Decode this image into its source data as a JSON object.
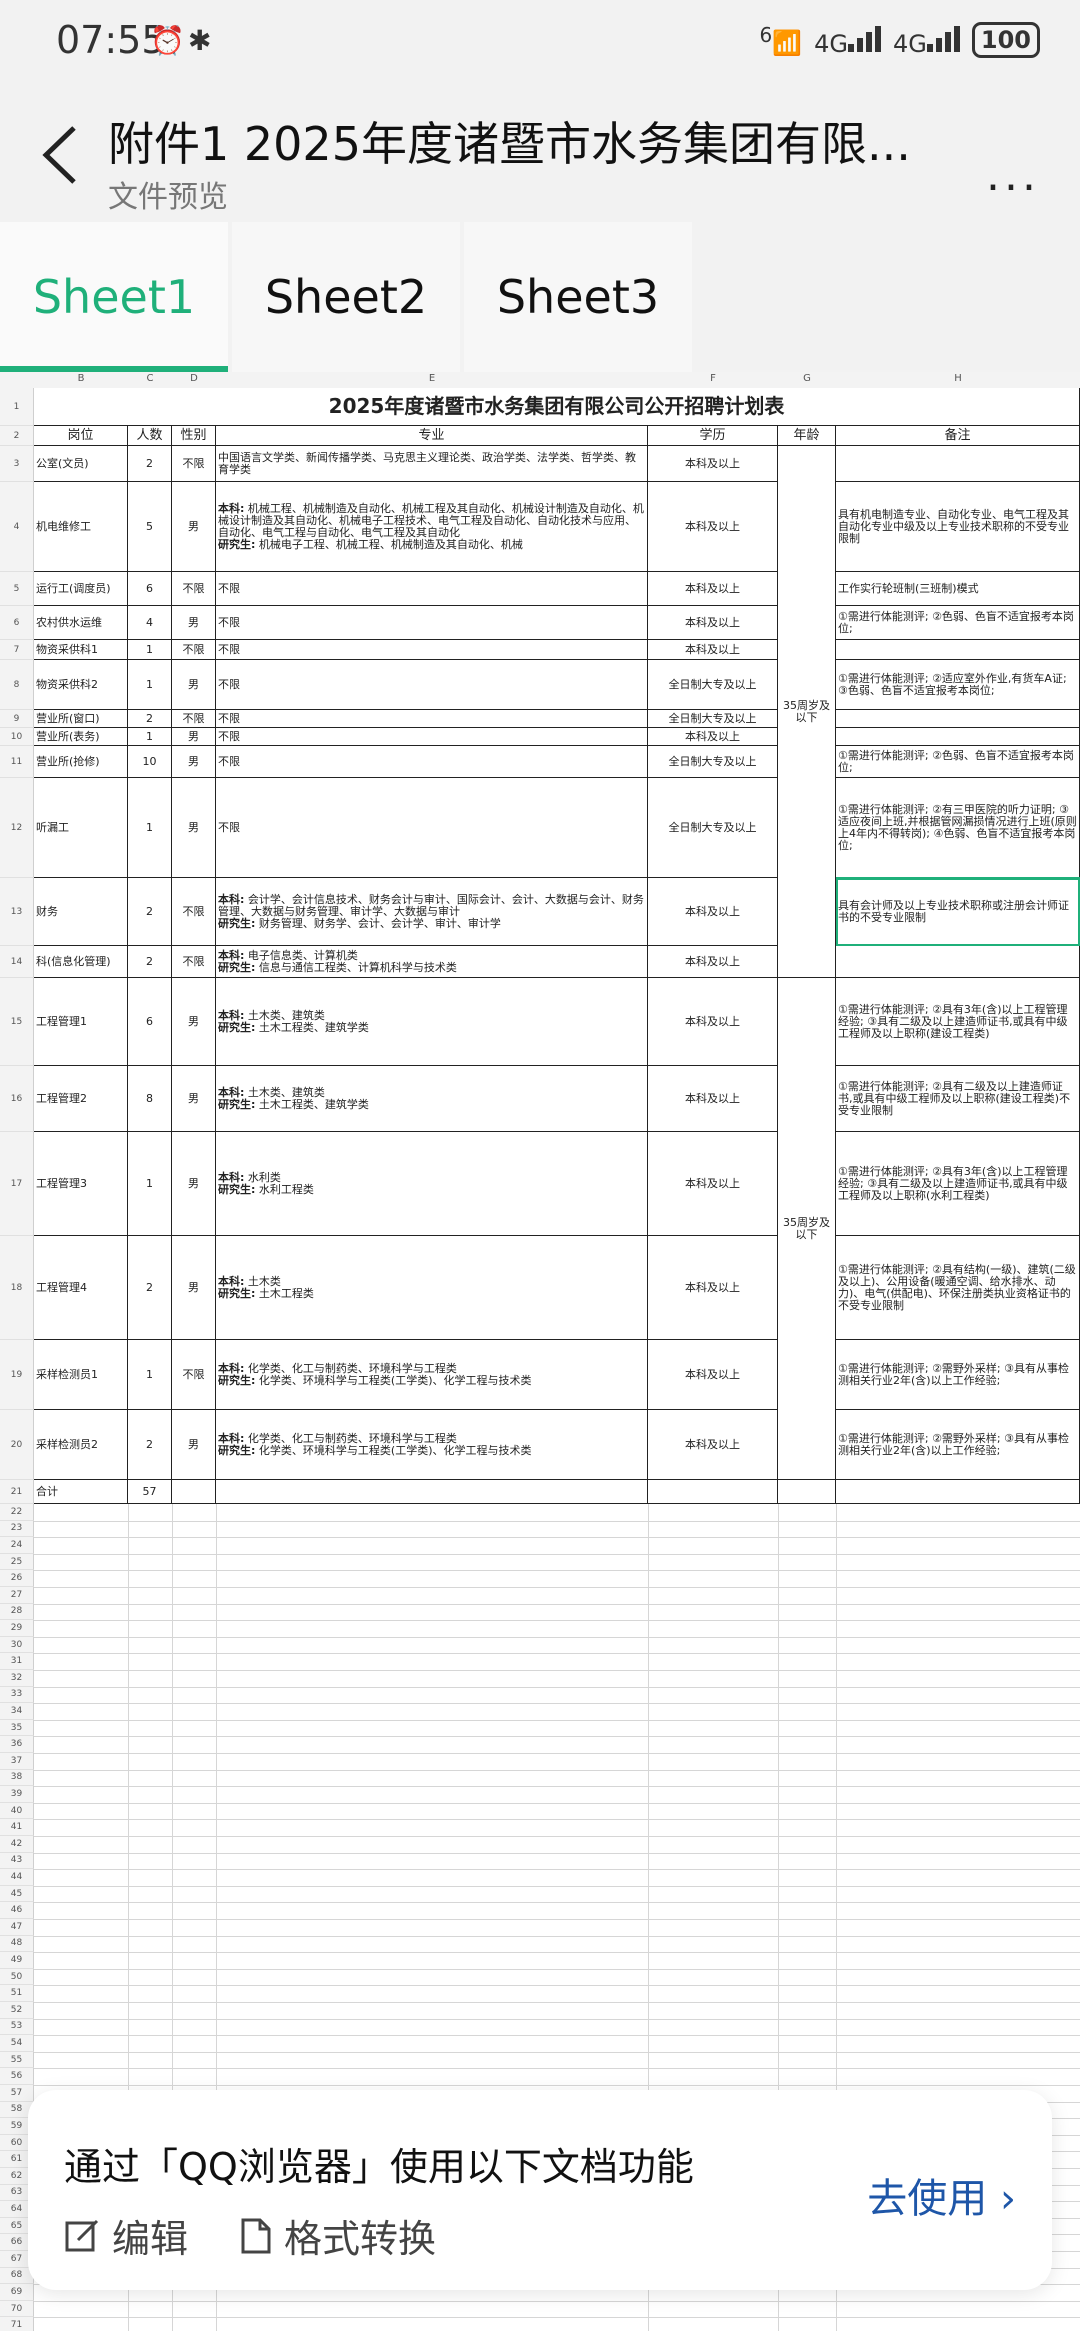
{
  "status": {
    "time": "07:55",
    "alarm_icon": "alarm-icon",
    "bluetooth_icon": "bluetooth-icon",
    "wifi_label": "6",
    "net1": "4G",
    "net2": "4G",
    "battery": "100"
  },
  "header": {
    "title": "附件1 2025年度诸暨市水务集团有限...",
    "subtitle": "文件预览",
    "more": "..."
  },
  "tabs": [
    {
      "label": "Sheet1",
      "active": true
    },
    {
      "label": "Sheet2",
      "active": false
    },
    {
      "label": "Sheet3",
      "active": false
    }
  ],
  "sheet": {
    "col_headers": [
      "B",
      "C",
      "D",
      "E",
      "F",
      "G",
      "H"
    ],
    "title": "2025年度诸暨市水务集团有限公司公开招聘计划表",
    "headers": {
      "post": "岗位",
      "count": "人数",
      "gender": "性别",
      "major": "专业",
      "edu": "学历",
      "age": "年龄",
      "note": "备注"
    },
    "age_groups": [
      "35周岁及以下",
      "35周岁及以下"
    ],
    "rows": [
      {
        "n": "3",
        "post": "公室(文员)",
        "count": "2",
        "gender": "不限",
        "major": "中国语言文学类、新闻传播学类、马克思主义理论类、政治学类、法学类、哲学类、教育学类",
        "edu": "本科及以上",
        "note": ""
      },
      {
        "n": "4",
        "post": "机电维修工",
        "count": "5",
        "gender": "男",
        "major_b1": "本科:",
        "major": " 机械工程、机械制造及自动化、机械工程及其自动化、机械设计制造及自动化、机械设计制造及其自动化、机械电子工程技术、电气工程及自动化、自动化技术与应用、自动化、电气工程与自动化、电气工程及其自动化",
        "major_b2": "研究生:",
        "major2": " 机械电子工程、机械工程、机械制造及其自动化、机械",
        "edu": "本科及以上",
        "note": "具有机电制造专业、自动化专业、电气工程及其自动化专业中级及以上专业技术职称的不受专业限制"
      },
      {
        "n": "5",
        "post": "运行工(调度员)",
        "count": "6",
        "gender": "不限",
        "major": "不限",
        "edu": "本科及以上",
        "note": "工作实行轮班制(三班制)模式"
      },
      {
        "n": "6",
        "post": "农村供水运维",
        "count": "4",
        "gender": "男",
        "major": "不限",
        "edu": "本科及以上",
        "note": "①需进行体能测评;      ②色弱、色盲不适宜报考本岗位;"
      },
      {
        "n": "7",
        "post": "物资采供科1",
        "count": "1",
        "gender": "不限",
        "major": "不限",
        "edu": "本科及以上",
        "note": ""
      },
      {
        "n": "8",
        "post": "物资采供科2",
        "count": "1",
        "gender": "男",
        "major": "不限",
        "edu": "全日制大专及以上",
        "note": "①需进行体能测评;      ②适应室外作业,有货车A证;      ③色弱、色盲不适宜报考本岗位;"
      },
      {
        "n": "9",
        "post": "营业所(窗口)",
        "count": "2",
        "gender": "不限",
        "major": "不限",
        "edu": "全日制大专及以上",
        "note": ""
      },
      {
        "n": "10",
        "post": "营业所(表务)",
        "count": "1",
        "gender": "男",
        "major": "不限",
        "edu": "本科及以上",
        "note": ""
      },
      {
        "n": "11",
        "post": "营业所(抢修)",
        "count": "10",
        "gender": "男",
        "major": "不限",
        "edu": "全日制大专及以上",
        "note": "①需进行体能测评;      ②色弱、色盲不适宜报考本岗位;"
      },
      {
        "n": "12",
        "post": "听漏工",
        "count": "1",
        "gender": "男",
        "major": "不限",
        "edu": "全日制大专及以上",
        "note": "①需进行体能测评;      ②有三甲医院的听力证明;      ③适应夜间上班,并根据管网漏损情况进行上班(原则上4年内不得转岗);      ④色弱、色盲不适宜报考本岗位;"
      },
      {
        "n": "13",
        "post": "财务",
        "count": "2",
        "gender": "不限",
        "major_b1": "本科:",
        "major": " 会计学、会计信息技术、财务会计与审计、国际会计、会计、大数据与会计、财务管理、大数据与财务管理、审计学、大数据与审计",
        "major_b2": "研究生:",
        "major2": " 财务管理、财务学、会计、会计学、审计、审计学",
        "edu": "本科及以上",
        "note": "具有会计师及以上专业技术职称或注册会计师证书的不受专业限制"
      },
      {
        "n": "14",
        "post": "科(信息化管理)",
        "count": "2",
        "gender": "不限",
        "major_b1": "本科:",
        "major": " 电子信息类、计算机类",
        "major_b2": "研究生:",
        "major2": " 信息与通信工程类、计算机科学与技术类",
        "edu": "本科及以上",
        "note": ""
      },
      {
        "n": "15",
        "post": "工程管理1",
        "count": "6",
        "gender": "男",
        "major_b1": "本科:",
        "major": " 土木类、建筑类",
        "major_b2": "研究生:",
        "major2": " 土木工程类、建筑学类",
        "edu": "本科及以上",
        "note": "①需进行体能测评;      ②具有3年(含)以上工程管理经验;      ③具有二级及以上建造师证书,或具有中级工程师及以上职称(建设工程类)"
      },
      {
        "n": "16",
        "post": "工程管理2",
        "count": "8",
        "gender": "男",
        "major_b1": "本科:",
        "major": " 土木类、建筑类",
        "major_b2": "研究生:",
        "major2": " 土木工程类、建筑学类",
        "edu": "本科及以上",
        "note": "①需进行体能测评;      ②具有二级及以上建造师证书,或具有中级工程师及以上职称(建设工程类)不受专业限制"
      },
      {
        "n": "17",
        "post": "工程管理3",
        "count": "1",
        "gender": "男",
        "major_b1": "本科:",
        "major": " 水利类",
        "major_b2": "研究生:",
        "major2": " 水利工程类",
        "edu": "本科及以上",
        "note": "①需进行体能测评;      ②具有3年(含)以上工程管理经验;      ③具有二级及以上建造师证书,或具有中级工程师及以上职称(水利工程类)"
      },
      {
        "n": "18",
        "post": "工程管理4",
        "count": "2",
        "gender": "男",
        "major_b1": "本科:",
        "major": " 土木类",
        "major_b2": "研究生:",
        "major2": " 土木工程类",
        "edu": "本科及以上",
        "note": "①需进行体能测评;      ②具有结构(一级)、建筑(二级及以上)、公用设备(暖通空调、给水排水、动力)、电气(供配电)、环保注册类执业资格证书的不受专业限制"
      },
      {
        "n": "19",
        "post": "采样检测员1",
        "count": "1",
        "gender": "不限",
        "major_b1": "本科:",
        "major": " 化学类、化工与制药类、环境科学与工程类",
        "major_b2": "研究生:",
        "major2": " 化学类、环境科学与工程类(工学类)、化学工程与技术类",
        "edu": "本科及以上",
        "note": "①需进行体能测评;      ②需野外采样;      ③具有从事检测相关行业2年(含)以上工作经验;"
      },
      {
        "n": "20",
        "post": "采样检测员2",
        "count": "2",
        "gender": "男",
        "major_b1": "本科:",
        "major": " 化学类、化工与制药类、环境科学与工程类",
        "major_b2": "研究生:",
        "major2": " 化学类、环境科学与工程类(工学类)、化学工程与技术类",
        "edu": "本科及以上",
        "note": "①需进行体能测评;      ②需野外采样;      ③具有从事检测相关行业2年(含)以上工作经验;"
      },
      {
        "n": "21",
        "post": "合计",
        "count": "57",
        "gender": "",
        "major": "",
        "edu": "",
        "note": ""
      }
    ]
  },
  "banner": {
    "title": "通过「QQ浏览器」使用以下文档功能",
    "edit": "编辑",
    "convert": "格式转换",
    "cta": "去使用"
  },
  "colors": {
    "accent": "#1fb07a",
    "link": "#1e56a8"
  }
}
